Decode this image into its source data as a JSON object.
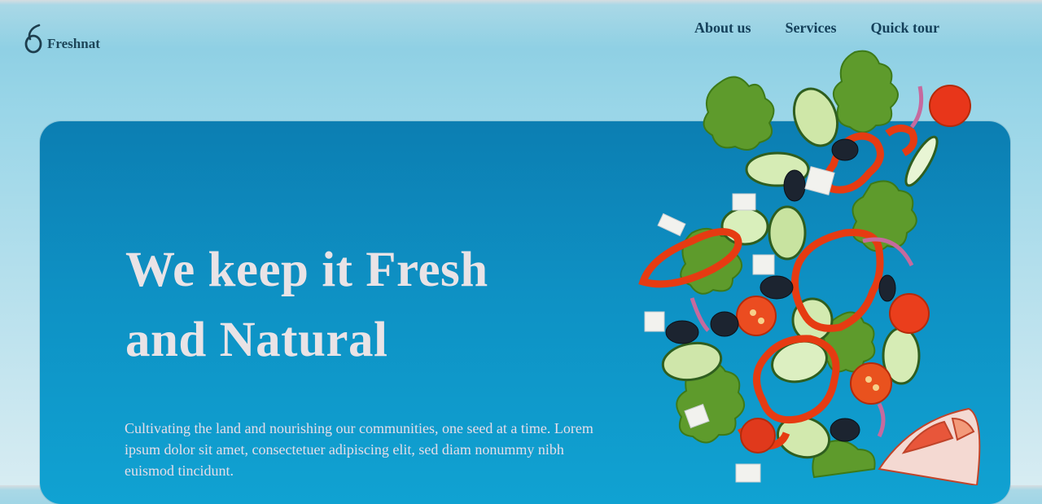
{
  "brand": {
    "name": "Freshnat",
    "logo_icon": "leaf-seed-icon"
  },
  "nav": {
    "items": [
      {
        "label": "About us"
      },
      {
        "label": "Services"
      },
      {
        "label": "Quick tour"
      }
    ]
  },
  "hero": {
    "title_line1": "We keep it Fresh",
    "title_line2": "and Natural",
    "description": "Cultivating the land and nourishing our communities, one seed at a time. Lorem ipsum dolor sit amet, consectetuer adipiscing elit, sed diam nonummy nibh euismod tincidunt.",
    "image": "flying-salad-illustration"
  },
  "colors": {
    "page_background": "#a9d8e6",
    "hero_background": "#0e91c4",
    "nav_text": "#14405a",
    "hero_text": "#e9e3e6"
  }
}
